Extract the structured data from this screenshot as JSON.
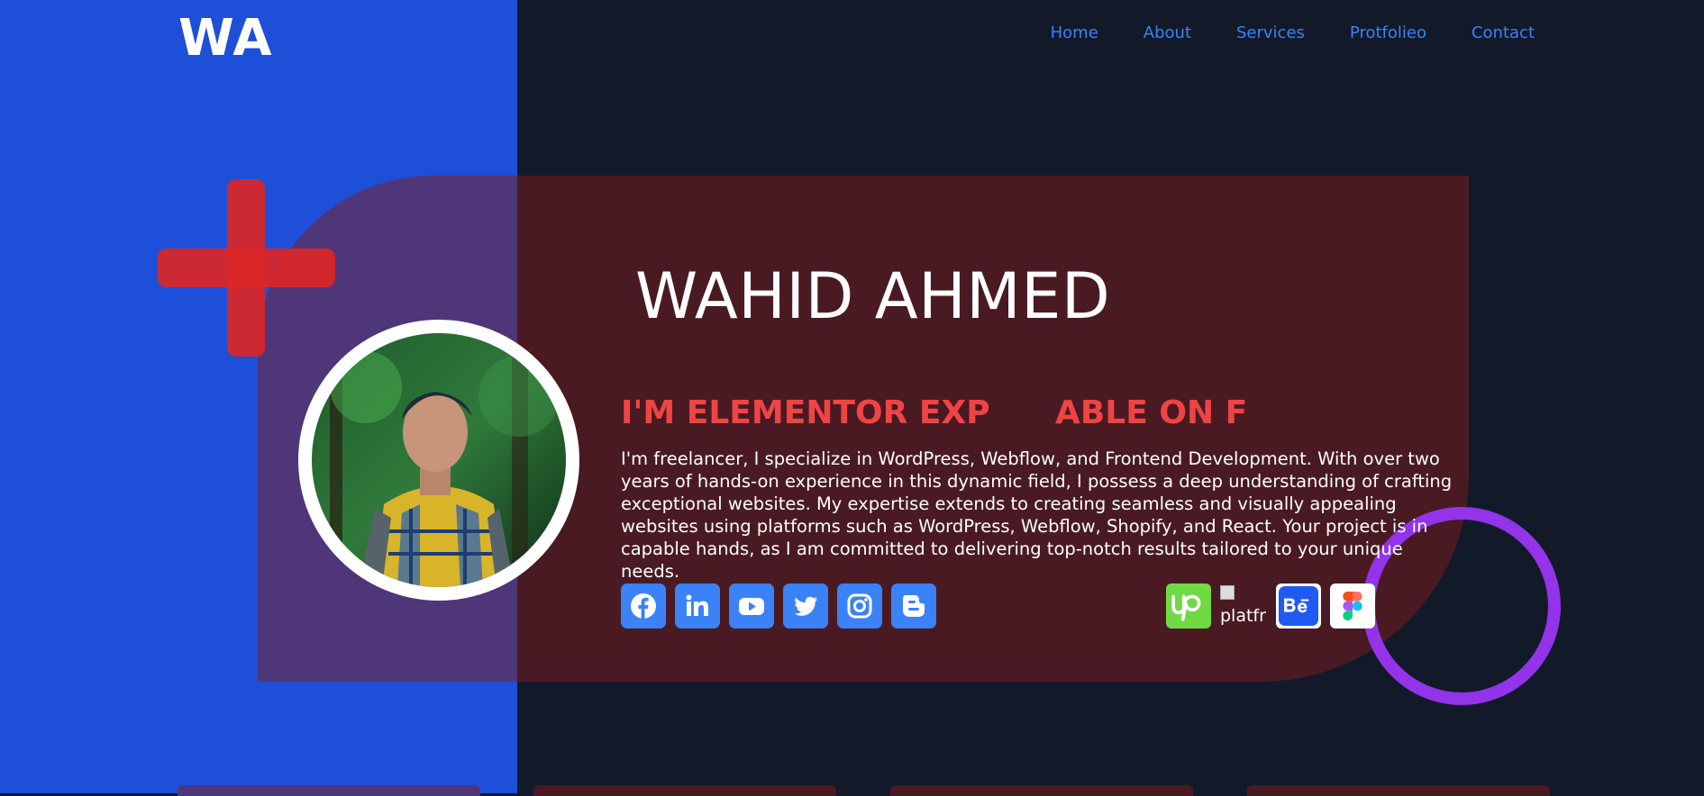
{
  "brand": {
    "logo": "WA"
  },
  "nav": {
    "items": [
      "Home",
      "About",
      "Services",
      "Protfolieo",
      "Contact"
    ]
  },
  "hero": {
    "name": "WAHID AHMED",
    "role_left": "I'M ELEMENTOR EXP",
    "role_right": "ABLE ON F",
    "bio": "I'm freelancer, I specialize in WordPress, Webflow, and Frontend Development. With over two years of hands-on experience in this dynamic field, I possess a deep understanding of crafting exceptional websites. My expertise extends to creating seamless and visually appealing websites using platforms such as WordPress, Webflow, Shopify, and React. Your project is in capable hands, as I am committed to delivering top-notch results tailored to your unique needs.",
    "avatar": "profile-photo"
  },
  "social": [
    "facebook-icon",
    "linkedin-icon",
    "youtube-icon",
    "twitter-icon",
    "instagram-icon",
    "blogger-icon"
  ],
  "platforms": {
    "items": [
      "upwork-icon",
      "broken-image",
      "behance-icon",
      "figma-icon"
    ],
    "broken_alt": "platfr"
  },
  "colors": {
    "left_panel": "#1e4fd8",
    "page_bg": "#121a2a",
    "accent_red": "#ef4444",
    "nav_blue": "#3b82f6",
    "ring_purple": "#9333ea"
  }
}
